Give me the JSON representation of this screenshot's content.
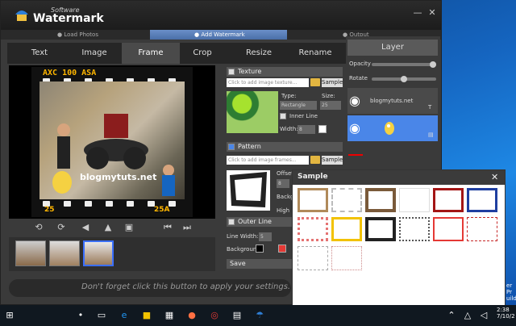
{
  "app": {
    "brand_small": "Software",
    "brand": "Watermark",
    "minimize": "—",
    "close": "✕"
  },
  "steps": [
    {
      "label": "● Load Photos"
    },
    {
      "label": "● Add Watermark"
    },
    {
      "label": "● Output"
    }
  ],
  "tabs": [
    {
      "label": "Text"
    },
    {
      "label": "Image"
    },
    {
      "label": "Frame"
    },
    {
      "label": "Crop"
    },
    {
      "label": "Resize"
    },
    {
      "label": "Rename"
    }
  ],
  "preview": {
    "film_text": "AXC 100 ASA",
    "film_num_left": "25",
    "film_num_right": "25A",
    "watermark_text": "blogmytuts.net"
  },
  "apply_hint": "Don't forget click this button to apply your settings.",
  "texture": {
    "header": "Texture",
    "input_placeholder": "Click to add image texture...",
    "sample_btn": "Sample",
    "type_label": "Type:",
    "type_value": "Rectangle",
    "size_label": "Size:",
    "size_value": "25",
    "inner_line_label": "Inner Line",
    "width_label": "Width:",
    "width_value": "8"
  },
  "pattern": {
    "header": "Pattern",
    "input_placeholder": "Click to add image frames...",
    "sample_btn": "Sample",
    "offset_label": "Offset",
    "offset_value": "8",
    "background_label": "Backgr",
    "high_label": "High"
  },
  "outer_line": {
    "header": "Outer Line",
    "line_width_label": "Line Width:",
    "line_width_value": "5",
    "background_label": "Background:"
  },
  "save_label": "Save",
  "layer": {
    "header": "Layer",
    "opacity_label": "Opacity",
    "rotate_label": "Rotate",
    "items": [
      {
        "label": "blogmytuts.net",
        "type_icon": "T"
      },
      {
        "label": "",
        "type_icon": "▤"
      }
    ]
  },
  "sample_dialog": {
    "title": "Sample",
    "close": "✕"
  },
  "taskbar": {
    "clock_line1": "2:38",
    "clock_line2": "7/10/2",
    "notif_line1": "er Pr",
    "notif_line2": "uild"
  },
  "colors": {
    "accent_blue": "#4a86e8",
    "film_orange": "#ffb600",
    "red_arrow": "#e00000"
  }
}
